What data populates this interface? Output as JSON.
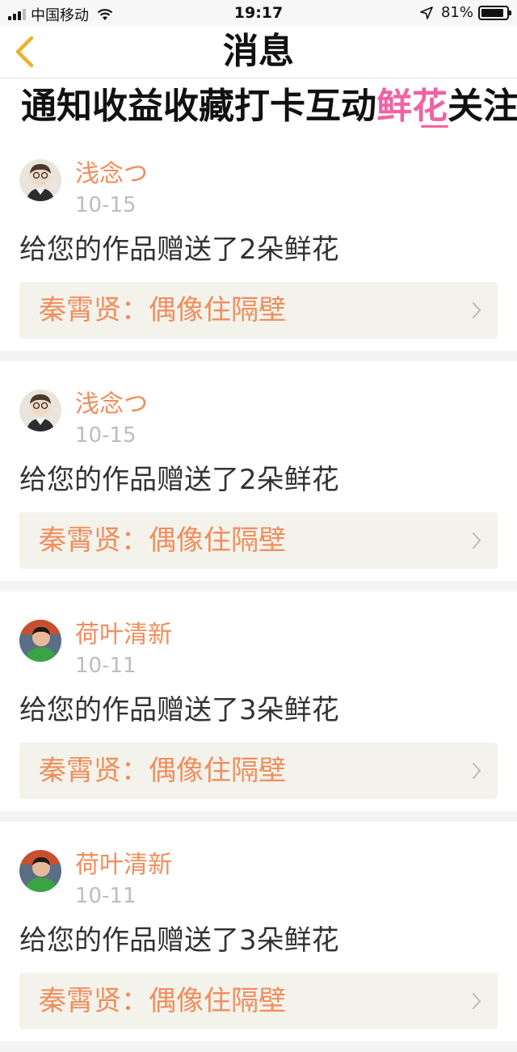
{
  "status_bar": {
    "carrier": "中国移动",
    "time": "19:17",
    "battery": "81%"
  },
  "nav": {
    "title": "消息"
  },
  "tabs": [
    {
      "label": "通知",
      "active": false
    },
    {
      "label": "收益",
      "active": false
    },
    {
      "label": "收藏",
      "active": false
    },
    {
      "label": "打卡",
      "active": false
    },
    {
      "label": "互动",
      "active": false
    },
    {
      "label": "鲜花",
      "active": true
    },
    {
      "label": "关注",
      "active": false
    }
  ],
  "messages": [
    {
      "user": "浅念つ",
      "date": "10-15",
      "text": "给您的作品赠送了2朵鲜花",
      "work": "秦霄贤：偶像住隔壁"
    },
    {
      "user": "浅念つ",
      "date": "10-15",
      "text": "给您的作品赠送了2朵鲜花",
      "work": "秦霄贤：偶像住隔壁"
    },
    {
      "user": "荷叶清新",
      "date": "10-11",
      "text": "给您的作品赠送了3朵鲜花",
      "work": "秦霄贤：偶像住隔壁"
    },
    {
      "user": "荷叶清新",
      "date": "10-11",
      "text": "给您的作品赠送了3朵鲜花",
      "work": "秦霄贤：偶像住隔壁"
    }
  ],
  "colors": {
    "accent": "#f062a4",
    "username": "#f28d5c",
    "date": "#bdbdbd",
    "link_bg": "#f3f3ec",
    "back_arrow": "#e8b52e"
  }
}
